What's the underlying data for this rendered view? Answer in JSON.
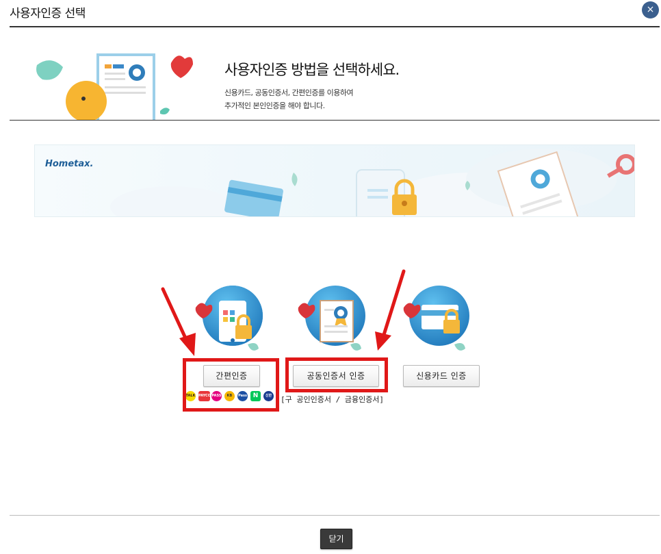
{
  "window": {
    "title": "사용자인증 선택",
    "close_label": "×"
  },
  "intro": {
    "heading": "사용자인증 방법을 선택하세요.",
    "desc_line1": "신용카드, 공동인증서, 간편인증를 이용하여",
    "desc_line2": "추가적인 본인인증을 해야 합니다."
  },
  "banner": {
    "logo": "Hometax."
  },
  "options": [
    {
      "id": "simple",
      "label": "간편인증",
      "icon": "phone-lock-icon"
    },
    {
      "id": "joint-cert",
      "label": "공동인증서 인증",
      "note": "[구 공인인증서 / 금융인증서]",
      "icon": "certificate-icon"
    },
    {
      "id": "credit-card",
      "label": "신용카드 인증",
      "icon": "credit-card-lock-icon"
    }
  ],
  "simple_auth_apps": [
    {
      "name": "kakao",
      "text": "TALK",
      "color": "#f7d900"
    },
    {
      "name": "payco",
      "text": "PAYCO",
      "color": "#e8363a"
    },
    {
      "name": "pass",
      "text": "PASS",
      "color": "#e4007f"
    },
    {
      "name": "kb",
      "text": "KB",
      "color": "#f6b600"
    },
    {
      "name": "samsung",
      "text": "Pass",
      "color": "#1c4fa3"
    },
    {
      "name": "naver",
      "text": "N",
      "color": "#03c75a"
    },
    {
      "name": "shinhan",
      "text": "신한",
      "color": "#1a3c8f"
    }
  ],
  "footer": {
    "close_button": "닫기"
  },
  "colors": {
    "accent_blue": "#3b5f8e",
    "highlight_red": "#e01818",
    "heart_red": "#e23a3a",
    "icon_blue": "#1f8fd0"
  }
}
